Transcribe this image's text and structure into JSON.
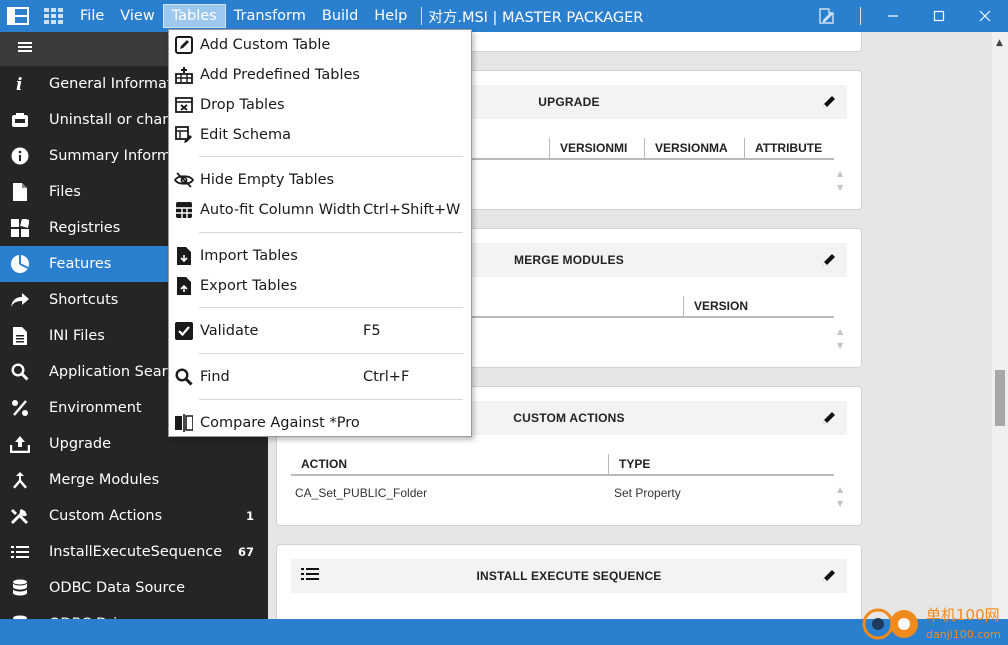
{
  "titlebar": {
    "menus": [
      "File",
      "View",
      "Tables",
      "Transform",
      "Build",
      "Help"
    ],
    "active_menu": "Tables",
    "title": "对方.MSI | MASTER PACKAGER"
  },
  "sidebar": {
    "items": [
      {
        "label": "General Information",
        "icon": "info-italic-icon"
      },
      {
        "label": "Uninstall or change",
        "icon": "uninstall-icon"
      },
      {
        "label": "Summary Information",
        "icon": "info-circle-icon"
      },
      {
        "label": "Files",
        "icon": "file-icon"
      },
      {
        "label": "Registries",
        "icon": "registry-icon"
      },
      {
        "label": "Features",
        "icon": "features-pie-icon",
        "active": true
      },
      {
        "label": "Shortcuts",
        "icon": "shortcut-arrow-icon"
      },
      {
        "label": "INI Files",
        "icon": "ini-file-icon"
      },
      {
        "label": "Application Search",
        "icon": "search-icon"
      },
      {
        "label": "Environment",
        "icon": "percent-icon"
      },
      {
        "label": "Upgrade",
        "icon": "upgrade-icon"
      },
      {
        "label": "Merge Modules",
        "icon": "merge-icon"
      },
      {
        "label": "Custom Actions",
        "icon": "tools-icon",
        "count": "1"
      },
      {
        "label": "InstallExecuteSequence",
        "icon": "list-icon",
        "count": "67"
      },
      {
        "label": "ODBC Data Source",
        "icon": "database-icon"
      },
      {
        "label": "ODBC Driver",
        "icon": "database-icon"
      }
    ]
  },
  "menu": {
    "items": [
      {
        "label": "Add Custom Table",
        "icon": "edit-box-icon",
        "shortcut": ""
      },
      {
        "label": "Add Predefined Tables",
        "icon": "predefined-tables-icon",
        "shortcut": ""
      },
      {
        "label": "Drop Tables",
        "icon": "drop-table-icon",
        "shortcut": ""
      },
      {
        "label": "Edit Schema",
        "icon": "edit-schema-icon",
        "shortcut": ""
      },
      {
        "label": "Hide Empty Tables",
        "icon": "eye-off-icon",
        "shortcut": ""
      },
      {
        "label": "Auto-fit Column Width",
        "icon": "table-autofit-icon",
        "shortcut": "Ctrl+Shift+W"
      },
      {
        "label": "Import Tables",
        "icon": "import-file-icon",
        "shortcut": ""
      },
      {
        "label": "Export Tables",
        "icon": "export-file-icon",
        "shortcut": ""
      },
      {
        "label": "Validate",
        "icon": "checkbox-icon",
        "shortcut": "F5"
      },
      {
        "label": "Find",
        "icon": "search-icon",
        "shortcut": "Ctrl+F"
      },
      {
        "label": "Compare Against *Pro",
        "icon": "compare-icon",
        "shortcut": ""
      }
    ]
  },
  "cards": {
    "upgrade": {
      "title": "UPGRADE",
      "columns": [
        "VERSIONMI",
        "VERSIONMA",
        "ATTRIBUTE"
      ]
    },
    "merge": {
      "title": "MERGE MODULES",
      "columns": [
        "VERSION"
      ]
    },
    "custom_actions": {
      "title": "CUSTOM ACTIONS",
      "columns": [
        "ACTION",
        "TYPE"
      ],
      "rows": [
        [
          "CA_Set_PUBLIC_Folder",
          "Set Property"
        ]
      ]
    },
    "ies": {
      "title": "INSTALL EXECUTE SEQUENCE"
    }
  },
  "watermark": {
    "line1": "单机100网",
    "line2": "danji100.com"
  },
  "colors": {
    "accent": "#2b7fcf",
    "sidebar": "#252525",
    "menu_active": "#9cc7ef"
  }
}
